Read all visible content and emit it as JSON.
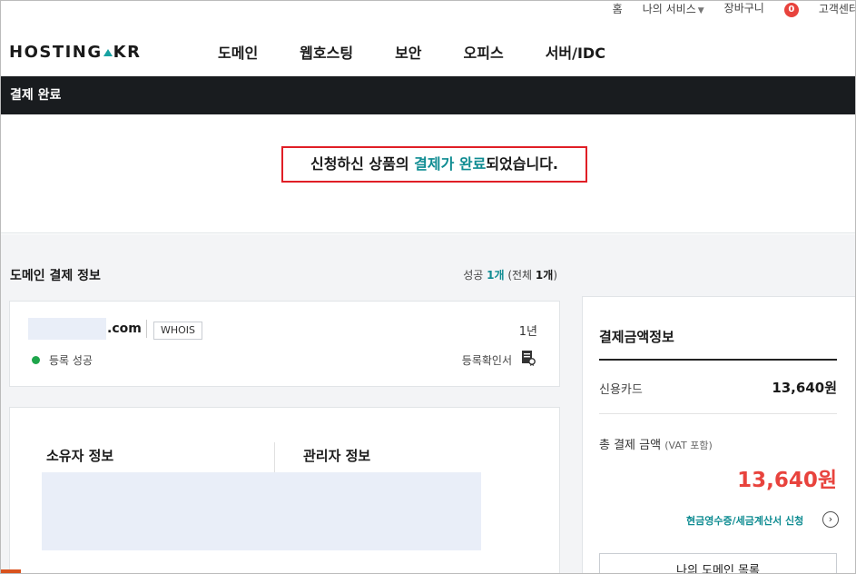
{
  "util": {
    "home": "홈",
    "my_services": "나의 서비스",
    "cart": "장바구니",
    "cart_count": "0",
    "help": "고객센터"
  },
  "header": {
    "logo_left": "HOSTING",
    "logo_right": "KR",
    "nav": [
      "도메인",
      "웹호스팅",
      "보안",
      "오피스",
      "서버/IDC"
    ]
  },
  "page_title": "결제 완료",
  "done_message": {
    "pre": "신청하신 상품의 ",
    "highlight": "결제가 완료",
    "post": "되었습니다."
  },
  "domain_section": {
    "title": "도메인 결제 정보",
    "count_label": "성공",
    "count_value": "1개",
    "total_label": "(전체",
    "total_value": "1개",
    "total_close": ")",
    "item": {
      "tld": ".com",
      "whois": "WHOIS",
      "term": "1년",
      "status": "등록 성공",
      "cert_link": "등록확인서"
    },
    "owner_title": "소유자 정보",
    "admin_title": "관리자 정보"
  },
  "payment": {
    "title": "결제금액정보",
    "method": "신용카드",
    "method_amount": "13,640원",
    "total_label": "총 결제 금액",
    "total_note": "(VAT 포함)",
    "total_amount": "13,640원",
    "receipt_link": "현금영수증/세금계산서 신청",
    "my_domain_button": "나의 도메인 목록"
  },
  "colors": {
    "accent": "#0f8c92",
    "alert": "#e8433d",
    "success": "#1ea54b",
    "titlebar": "#191c1f",
    "highlight_border": "#e01f26"
  }
}
